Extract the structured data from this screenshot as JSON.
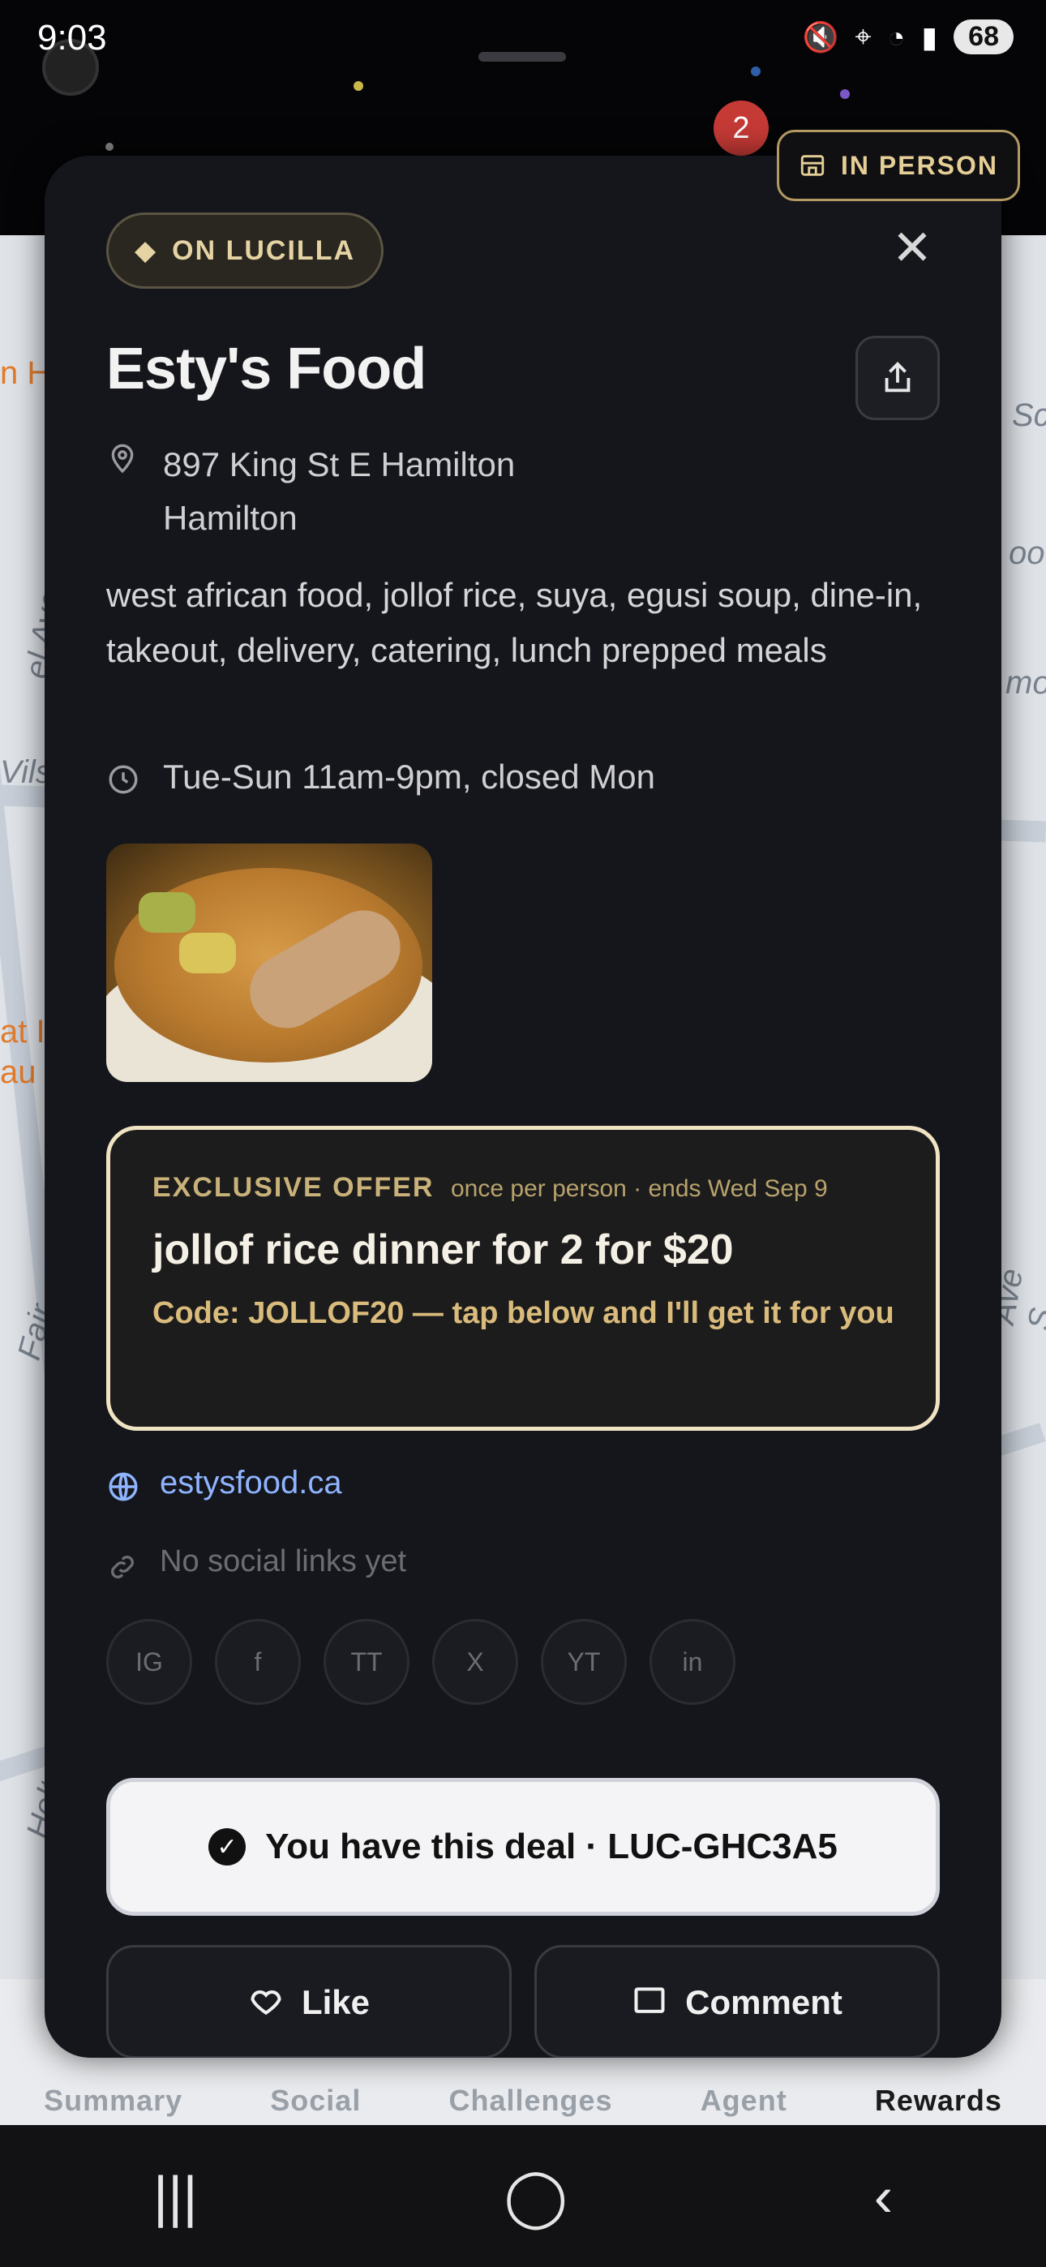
{
  "status_bar": {
    "time": "9:03",
    "battery": "68"
  },
  "notification_count": "2",
  "mode_button": {
    "label": "IN PERSON"
  },
  "map_labels": {
    "left_top": "n H",
    "right_top": "Sc",
    "right_food": "ood",
    "right_more": "mor",
    "left_ave": "el Ave",
    "left_wils": "Vils",
    "left_at": "at I",
    "left_au": "au",
    "right_ave_s": "e Ave S",
    "left_fair": "Fair",
    "left_holton": "Holton A"
  },
  "modal": {
    "chip_label": "ON LUCILLA",
    "business_name": "Esty's Food",
    "address_line1": "897 King St E Hamilton",
    "address_line2": "Hamilton",
    "description": "west african food, jollof rice, suya, egusi soup, dine-in, takeout, delivery, catering, lunch prepped meals",
    "hours": "Tue-Sun 11am-9pm, closed Mon",
    "offer": {
      "tag": "EXCLUSIVE OFFER",
      "meta": "once per person · ends Wed Sep 9",
      "title": "jollof rice dinner for 2 for $20",
      "code_text": "Code: JOLLOF20 — tap below and I'll get it for you"
    },
    "website": "estysfood.ca",
    "no_social_text": "No social links yet",
    "social_buttons": [
      "IG",
      "f",
      "TT",
      "X",
      "YT",
      "in"
    ],
    "deal_text": "You have this deal · LUC-GHC3A5",
    "like_label": "Like",
    "comment_label": "Comment"
  },
  "tabs": [
    "Summary",
    "Social",
    "Challenges",
    "Agent",
    "Rewards"
  ],
  "active_tab": "Rewards",
  "colors": {
    "card_bg": "#15161b",
    "gold": "#e5d3a3",
    "offer_border": "#efe3c2",
    "link": "#8fb4ff"
  }
}
